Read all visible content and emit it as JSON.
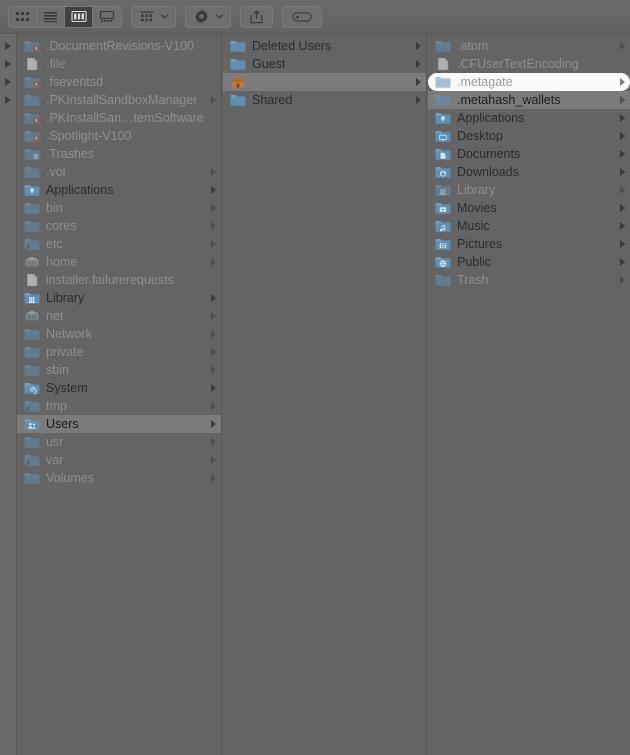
{
  "window": {
    "app": "Finder",
    "view_mode": "column",
    "state": "inactive-dimmed"
  },
  "toolbar": {
    "view_buttons": [
      {
        "name": "icon-view",
        "label": "Icon View",
        "icon": "grid-icon",
        "active": false
      },
      {
        "name": "list-view",
        "label": "List View",
        "icon": "list-icon",
        "active": false
      },
      {
        "name": "column-view",
        "label": "Column View",
        "icon": "columns-icon",
        "active": true
      },
      {
        "name": "gallery-view",
        "label": "Gallery View",
        "icon": "gallery-icon",
        "active": false
      }
    ],
    "group_button": {
      "label": "Group items",
      "icon": "group-icon",
      "chevron": "chevron-down-icon"
    },
    "action_button": {
      "label": "Action",
      "icon": "gear-icon",
      "chevron": "chevron-down-icon"
    },
    "share_button": {
      "label": "Share",
      "icon": "share-icon"
    },
    "tag_button": {
      "label": "Edit Tags",
      "icon": "tag-icon"
    }
  },
  "colors": {
    "window_bg": "#646464",
    "toolbar_bg": "#6b6b6b",
    "folder_blue": "#5f8fb4",
    "selection_grey": "#7b7b7b",
    "pill_white": "#fbfbfb",
    "text_dark": "#2c2c2c",
    "text_dim": "#8f8f8f",
    "house_orange": "#b5651f"
  },
  "columns": [
    {
      "id": "col1",
      "name": "root-volume-column",
      "items": [
        {
          "label": ".DocumentRevisions-V100",
          "icon": "locked-folder-icon",
          "dim": true,
          "arrow": false,
          "gutter_triangle": true,
          "selected": false,
          "pill": false
        },
        {
          "label": ".file",
          "icon": "file-icon",
          "dim": true,
          "arrow": false,
          "gutter_triangle": true,
          "selected": false,
          "pill": false
        },
        {
          "label": ".fseventsd",
          "icon": "locked-folder-icon",
          "dim": true,
          "arrow": false,
          "gutter_triangle": true,
          "selected": false,
          "pill": false
        },
        {
          "label": ".PKInstallSandboxManager",
          "icon": "folder-icon",
          "dim": true,
          "arrow": true,
          "gutter_triangle": true,
          "selected": false,
          "pill": false
        },
        {
          "label": ".PKInstallSan…temSoftware",
          "icon": "locked-folder-icon",
          "dim": true,
          "arrow": false,
          "gutter_triangle": false,
          "selected": false,
          "pill": false
        },
        {
          "label": ".Spotlight-V100",
          "icon": "locked-folder-icon",
          "dim": true,
          "arrow": false,
          "gutter_triangle": false,
          "selected": false,
          "pill": false
        },
        {
          "label": ".Trashes",
          "icon": "trash-folder-icon",
          "dim": true,
          "arrow": false,
          "gutter_triangle": false,
          "selected": false,
          "pill": false
        },
        {
          "label": ".vol",
          "icon": "folder-icon",
          "dim": true,
          "arrow": true,
          "gutter_triangle": false,
          "selected": false,
          "pill": false
        },
        {
          "label": "Applications",
          "icon": "applications-folder-icon",
          "dim": false,
          "arrow": true,
          "gutter_triangle": false,
          "selected": false,
          "pill": false
        },
        {
          "label": "bin",
          "icon": "folder-icon",
          "dim": true,
          "arrow": true,
          "gutter_triangle": false,
          "selected": false,
          "pill": false
        },
        {
          "label": "cores",
          "icon": "folder-icon",
          "dim": true,
          "arrow": true,
          "gutter_triangle": false,
          "selected": false,
          "pill": false
        },
        {
          "label": "etc",
          "icon": "alias-folder-icon",
          "dim": true,
          "arrow": true,
          "gutter_triangle": false,
          "selected": false,
          "pill": false
        },
        {
          "label": "home",
          "icon": "network-folder-icon",
          "dim": true,
          "arrow": true,
          "gutter_triangle": false,
          "selected": false,
          "pill": false
        },
        {
          "label": "installer.failurerequests",
          "icon": "file-icon",
          "dim": true,
          "arrow": false,
          "gutter_triangle": false,
          "selected": false,
          "pill": false
        },
        {
          "label": "Library",
          "icon": "library-folder-icon",
          "dim": false,
          "arrow": true,
          "gutter_triangle": false,
          "selected": false,
          "pill": false
        },
        {
          "label": "net",
          "icon": "network-folder-icon",
          "dim": true,
          "arrow": true,
          "gutter_triangle": false,
          "selected": false,
          "pill": false
        },
        {
          "label": "Network",
          "icon": "folder-icon",
          "dim": true,
          "arrow": true,
          "gutter_triangle": false,
          "selected": false,
          "pill": false
        },
        {
          "label": "private",
          "icon": "folder-icon",
          "dim": true,
          "arrow": true,
          "gutter_triangle": false,
          "selected": false,
          "pill": false
        },
        {
          "label": "sbin",
          "icon": "folder-icon",
          "dim": true,
          "arrow": true,
          "gutter_triangle": false,
          "selected": false,
          "pill": false
        },
        {
          "label": "System",
          "icon": "system-folder-icon",
          "dim": false,
          "arrow": true,
          "gutter_triangle": false,
          "selected": false,
          "pill": false
        },
        {
          "label": "tmp",
          "icon": "alias-folder-icon",
          "dim": true,
          "arrow": true,
          "gutter_triangle": false,
          "selected": false,
          "pill": false
        },
        {
          "label": "Users",
          "icon": "users-folder-icon",
          "dim": false,
          "arrow": true,
          "gutter_triangle": false,
          "selected": true,
          "pill": false
        },
        {
          "label": "usr",
          "icon": "folder-icon",
          "dim": true,
          "arrow": true,
          "gutter_triangle": false,
          "selected": false,
          "pill": false
        },
        {
          "label": "var",
          "icon": "alias-folder-icon",
          "dim": true,
          "arrow": true,
          "gutter_triangle": false,
          "selected": false,
          "pill": false
        },
        {
          "label": "Volumes",
          "icon": "folder-icon",
          "dim": true,
          "arrow": true,
          "gutter_triangle": false,
          "selected": false,
          "pill": false
        }
      ]
    },
    {
      "id": "col2",
      "name": "users-column",
      "items": [
        {
          "label": "Deleted Users",
          "icon": "folder-icon",
          "dim": false,
          "arrow": true,
          "selected": false,
          "pill": false,
          "redacted": false
        },
        {
          "label": "Guest",
          "icon": "folder-icon",
          "dim": false,
          "arrow": true,
          "selected": false,
          "pill": false,
          "redacted": false
        },
        {
          "label": "",
          "icon": "home-folder-icon",
          "dim": false,
          "arrow": true,
          "selected": true,
          "pill": false,
          "redacted": true
        },
        {
          "label": "Shared",
          "icon": "folder-icon",
          "dim": false,
          "arrow": true,
          "selected": false,
          "pill": false,
          "redacted": false
        }
      ]
    },
    {
      "id": "col3",
      "name": "home-folder-column",
      "items": [
        {
          "label": ".atom",
          "icon": "folder-icon",
          "dim": true,
          "arrow": true,
          "selected": false,
          "pill": false
        },
        {
          "label": ".CFUserTextEncoding",
          "icon": "file-icon",
          "dim": true,
          "arrow": false,
          "selected": false,
          "pill": false
        },
        {
          "label": ".metagate",
          "icon": "folder-icon",
          "dim": true,
          "arrow": true,
          "selected": false,
          "pill": true
        },
        {
          "label": ".metahash_wallets",
          "icon": "folder-icon",
          "dim": true,
          "arrow": true,
          "selected": true,
          "pill": false
        },
        {
          "label": "Applications",
          "icon": "applications-folder-icon",
          "dim": false,
          "arrow": true,
          "selected": false,
          "pill": false
        },
        {
          "label": "Desktop",
          "icon": "desktop-folder-icon",
          "dim": false,
          "arrow": true,
          "selected": false,
          "pill": false
        },
        {
          "label": "Documents",
          "icon": "documents-folder-icon",
          "dim": false,
          "arrow": true,
          "selected": false,
          "pill": false
        },
        {
          "label": "Downloads",
          "icon": "downloads-folder-icon",
          "dim": false,
          "arrow": true,
          "selected": false,
          "pill": false
        },
        {
          "label": "Library",
          "icon": "library-folder-icon",
          "dim": true,
          "arrow": true,
          "selected": false,
          "pill": false
        },
        {
          "label": "Movies",
          "icon": "movies-folder-icon",
          "dim": false,
          "arrow": true,
          "selected": false,
          "pill": false
        },
        {
          "label": "Music",
          "icon": "music-folder-icon",
          "dim": false,
          "arrow": true,
          "selected": false,
          "pill": false
        },
        {
          "label": "Pictures",
          "icon": "pictures-folder-icon",
          "dim": false,
          "arrow": true,
          "selected": false,
          "pill": false
        },
        {
          "label": "Public",
          "icon": "public-folder-icon",
          "dim": false,
          "arrow": true,
          "selected": false,
          "pill": false
        },
        {
          "label": "Trash",
          "icon": "folder-icon",
          "dim": true,
          "arrow": true,
          "selected": false,
          "pill": false
        }
      ]
    }
  ]
}
